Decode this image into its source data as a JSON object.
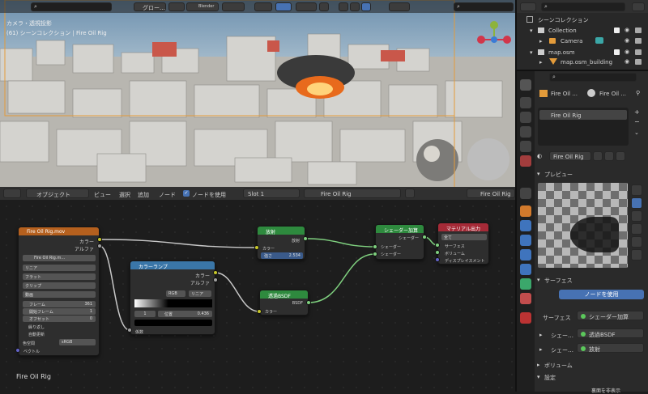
{
  "viewport": {
    "overlay_title": "カメラ・透視投影",
    "overlay_subtitle": "(61) シーンコレクション | Fire Oil Rig",
    "header": {
      "view_mode": "グロー…",
      "shading": "Blender",
      "search": ""
    }
  },
  "node_header": {
    "editor": "オブジェクト",
    "menus": [
      "ビュー",
      "選択",
      "追加",
      "ノード"
    ],
    "use_nodes_label": "ノードを使用",
    "slot": "Slot 1",
    "material": "Fire Oil Rig",
    "material_right": "Fire Oil Rig"
  },
  "node_editor": {
    "footer_label": "Fire Oil Rig",
    "nodes": {
      "image": {
        "title": "Fire Oil Rig.mov",
        "out_color": "カラー",
        "out_alpha": "アルファ",
        "file": "Fire Oil Rig.m…",
        "dd1": "リニア",
        "dd2": "フラット",
        "dd3": "クリップ",
        "dd4": "動画",
        "frames_label": "フレーム",
        "frames_value": "361",
        "start_label": "開始フレーム",
        "start_value": "1",
        "offset_label": "オフセット",
        "offset_value": "0",
        "cyclic": "繰り返し",
        "auto_refresh": "自動更新",
        "colorspace_label": "色空間",
        "colorspace_value": "sRGB",
        "vector": "ベクトル"
      },
      "ramp": {
        "title": "カラーランプ",
        "out_color": "カラー",
        "out_alpha": "アルファ",
        "mode": "RGB",
        "interp": "リニア",
        "index": "1",
        "pos_label": "位置",
        "pos_value": "0.436",
        "in_fac": "係数"
      },
      "emission": {
        "title": "放射",
        "out": "放射",
        "in_color": "カラー",
        "strength_label": "強さ",
        "strength_value": "2.534"
      },
      "transparent": {
        "title": "透過BSDF",
        "out": "BSDF",
        "in_color": "カラー"
      },
      "add": {
        "title": "シェーダー加算",
        "out": "シェーダー",
        "in1": "シェーダー",
        "in2": "シェーダー"
      },
      "output": {
        "title": "マテリアル出力",
        "target": "全て",
        "in_surface": "サーフェス",
        "in_volume": "ボリューム",
        "in_disp": "ディスプレイスメント"
      }
    }
  },
  "outliner": {
    "header": "シーンコレクション",
    "items": [
      {
        "label": "Collection"
      },
      {
        "label": "Camera"
      },
      {
        "label": "map.osm"
      },
      {
        "label": "map.osm_building"
      }
    ]
  },
  "properties": {
    "object_name": "Fire Oil ...",
    "material_tab_name": "Fire Oil ...",
    "slot_item": "Fire Oil Rig",
    "material_field": "Fire Oil Rig",
    "preview_header": "プレビュー",
    "surface_header": "サーフェス",
    "use_nodes_button": "ノードを使用",
    "surface_label": "サーフェス",
    "surface_value": "シェーダー加算",
    "sub1_label": "シェー…",
    "sub1_value": "透過BSDF",
    "sub2_label": "シェー…",
    "sub2_value": "放射",
    "volume_header": "ボリューム",
    "settings_header": "設定",
    "bottom_text": "裏面を非表示"
  }
}
